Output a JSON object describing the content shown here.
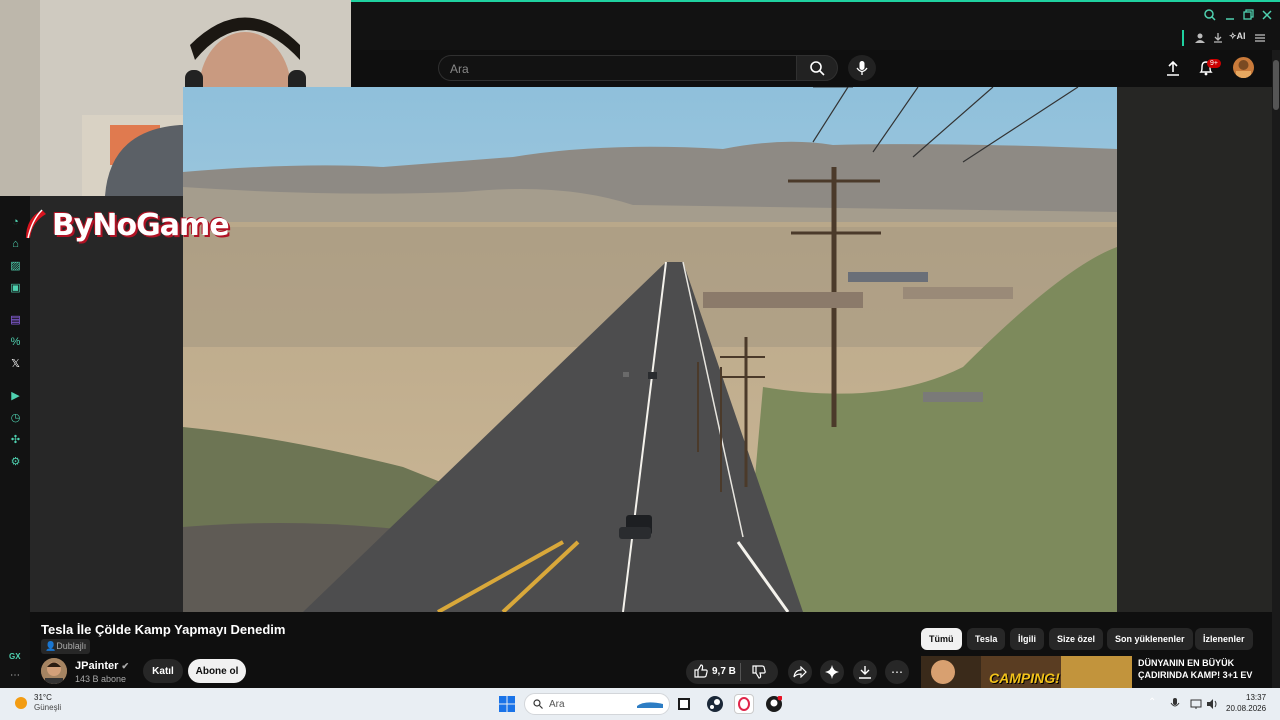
{
  "search": {
    "placeholder": "Ara"
  },
  "notifications": {
    "badge": "9+"
  },
  "opera_bar": {
    "ai_label": "AI"
  },
  "overlay": {
    "logo_text": "ByNoGame"
  },
  "video": {
    "title": "Tesla İle Çölde Kamp Yapmayı Denedim",
    "dubbed_label": "Dublajlı",
    "channel": "JPainter",
    "subscribers": "143 B abone",
    "join_label": "Katıl",
    "subscribe_label": "Abone ol",
    "likes": "9,7 B"
  },
  "chips": [
    "Tümü",
    "Tesla",
    "İlgili",
    "Size özel",
    "Son yüklenenler",
    "İzlenenler"
  ],
  "recommendation": {
    "thumb_text": "CAMPING!",
    "title_line1": "DÜNYANIN EN BÜYÜK",
    "title_line2": "ÇADIRINDA KAMP! 3+1 EV"
  },
  "sidebar": {
    "gx_label": "GX"
  },
  "taskbar": {
    "temperature": "31°C",
    "weather": "Güneşli",
    "search_placeholder": "Ara",
    "time": "13:37",
    "date": "20.08.2026"
  }
}
